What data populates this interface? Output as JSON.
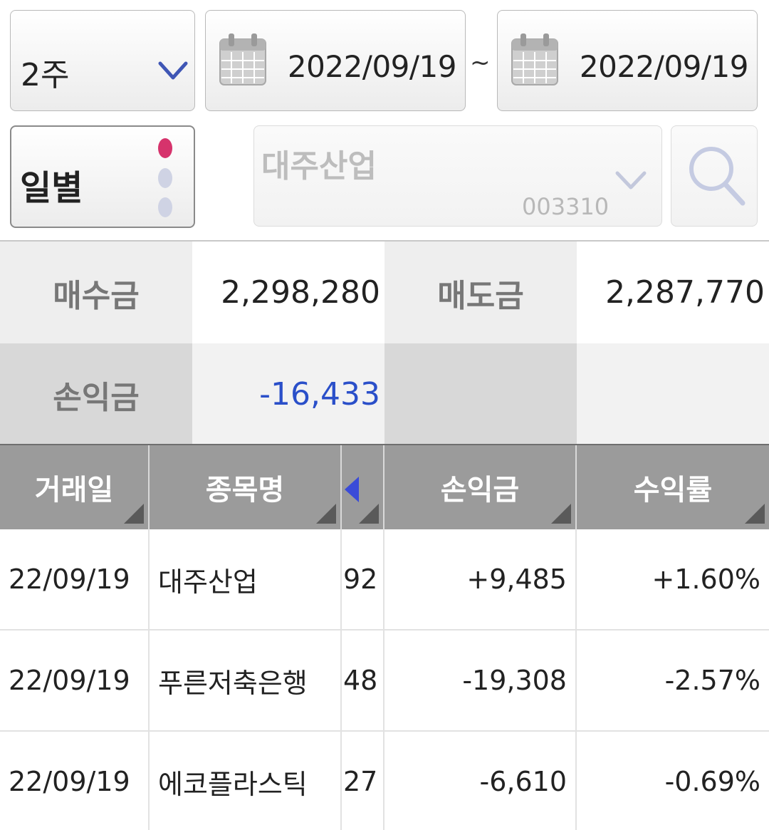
{
  "filters": {
    "period": "2주",
    "date_from": "2022/09/19",
    "date_sep": "~",
    "date_to": "2022/09/19",
    "mode": "일별",
    "stock_name": "대주산업",
    "stock_code": "003310"
  },
  "summary": {
    "buy_label": "매수금",
    "buy_value": "2,298,280",
    "sell_label": "매도금",
    "sell_value": "2,287,770",
    "pl_label": "손익금",
    "pl_value": "-16,433"
  },
  "table": {
    "headers": [
      "거래일",
      "종목명",
      "손익금",
      "수익률"
    ],
    "rows": [
      {
        "date": "22/09/19",
        "name": "대주산업",
        "qty": "92",
        "pl": "+9,485",
        "rate": "+1.60%",
        "sign": "pos"
      },
      {
        "date": "22/09/19",
        "name": "푸른저축은행",
        "qty": "48",
        "pl": "-19,308",
        "rate": "-2.57%",
        "sign": "neg"
      },
      {
        "date": "22/09/19",
        "name": "에코플라스틱",
        "qty": "27",
        "pl": "-6,610",
        "rate": "-0.69%",
        "sign": "neg"
      }
    ]
  },
  "colors": {
    "positive": "#d6336c",
    "negative": "#2a4fc9",
    "header_bg": "#9b9b9b",
    "mode_dot_active": "#d6336c"
  },
  "icons": [
    "chevron-down-icon",
    "calendar-icon",
    "search-icon",
    "sort-corner-icon",
    "scroll-left-icon"
  ]
}
